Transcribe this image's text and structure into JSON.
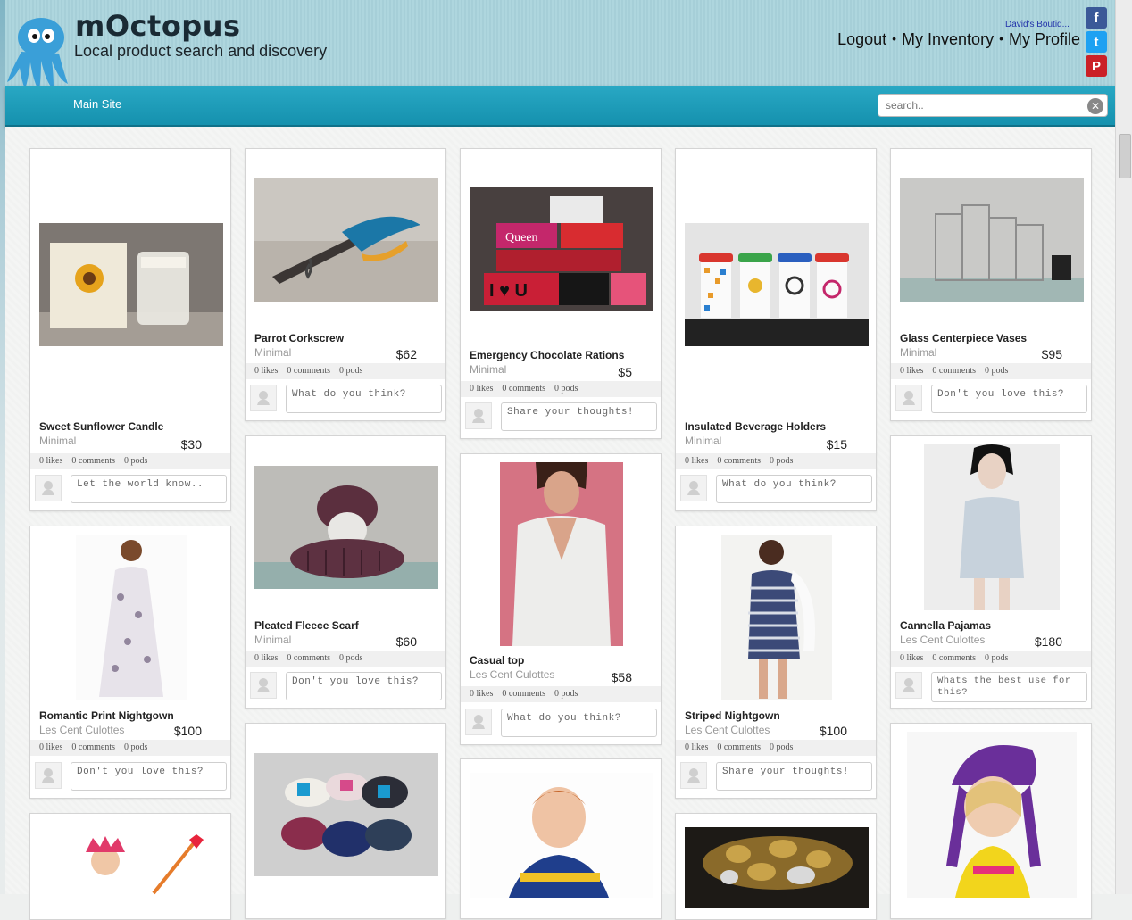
{
  "header": {
    "brand": "mOctopus",
    "tagline": "Local product search and discovery",
    "user_name": "David's Boutiq...",
    "links": {
      "logout": "Logout",
      "inventory": "My Inventory",
      "profile": "My Profile"
    },
    "separator": "•",
    "social": {
      "facebook": "f",
      "twitter": "t",
      "pinterest": "P"
    }
  },
  "nav": {
    "main_site": "Main Site"
  },
  "search": {
    "placeholder": "search..",
    "clear": "✕"
  },
  "cards": [
    {
      "title": "Sweet Sunflower Candle",
      "brand": "Minimal",
      "price": "$30",
      "likes": "0 likes",
      "comments": "0 comments",
      "pods": "0 pods",
      "placeholder": "Let the world know.."
    },
    {
      "title": "Parrot Corkscrew",
      "brand": "Minimal",
      "price": "$62",
      "likes": "0 likes",
      "comments": "0 comments",
      "pods": "0 pods",
      "placeholder": "What do you think?"
    },
    {
      "title": "Emergency Chocolate Rations",
      "brand": "Minimal",
      "price": "$5",
      "likes": "0 likes",
      "comments": "0 comments",
      "pods": "0 pods",
      "placeholder": "Share your thoughts!"
    },
    {
      "title": "Insulated Beverage Holders",
      "brand": "Minimal",
      "price": "$15",
      "likes": "0 likes",
      "comments": "0 comments",
      "pods": "0 pods",
      "placeholder": "What do you think?"
    },
    {
      "title": "Glass Centerpiece Vases",
      "brand": "Minimal",
      "price": "$95",
      "likes": "0 likes",
      "comments": "0 comments",
      "pods": "0 pods",
      "placeholder": "Don't you love this?"
    },
    {
      "title": "Pleated Fleece Scarf",
      "brand": "Minimal",
      "price": "$60",
      "likes": "0 likes",
      "comments": "0 comments",
      "pods": "0 pods",
      "placeholder": "Don't you love this?"
    },
    {
      "title": "Casual top",
      "brand": "Les Cent Culottes",
      "price": "$58",
      "likes": "0 likes",
      "comments": "0 comments",
      "pods": "0 pods",
      "placeholder": "What do you think?"
    },
    {
      "title": "Cannella Pajamas",
      "brand": "Les Cent Culottes",
      "price": "$180",
      "likes": "0 likes",
      "comments": "0 comments",
      "pods": "0 pods",
      "placeholder": "Whats the best use for this?"
    },
    {
      "title": "Romantic Print Nightgown",
      "brand": "Les Cent Culottes",
      "price": "$100",
      "likes": "0 likes",
      "comments": "0 comments",
      "pods": "0 pods",
      "placeholder": "Don't you love this?"
    },
    {
      "title": "Striped Nightgown",
      "brand": "Les Cent Culottes",
      "price": "$100",
      "likes": "0 likes",
      "comments": "0 comments",
      "pods": "0 pods",
      "placeholder": "Share your thoughts!"
    }
  ],
  "images": {
    "chocolate_label_1": "Queen",
    "chocolate_label_2": "I ♥ U"
  }
}
